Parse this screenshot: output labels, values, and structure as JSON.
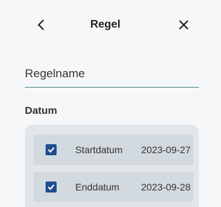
{
  "header": {
    "title": "Regel",
    "back_icon": "chevron-left-icon",
    "close_icon": "close-icon"
  },
  "form": {
    "name_placeholder": "Regelname",
    "name_value": "",
    "date_section_label": "Datum"
  },
  "dates": [
    {
      "label": "Startdatum",
      "value": "2023-09-27",
      "checked": true
    },
    {
      "label": "Enddatum",
      "value": "2023-09-28",
      "checked": true
    }
  ],
  "colors": {
    "accent": "#4f8d86",
    "checkbox": "#1f4e8c",
    "panel": "#e1e6ea",
    "row": "#d3dadf",
    "background": "#f5f7f9"
  }
}
